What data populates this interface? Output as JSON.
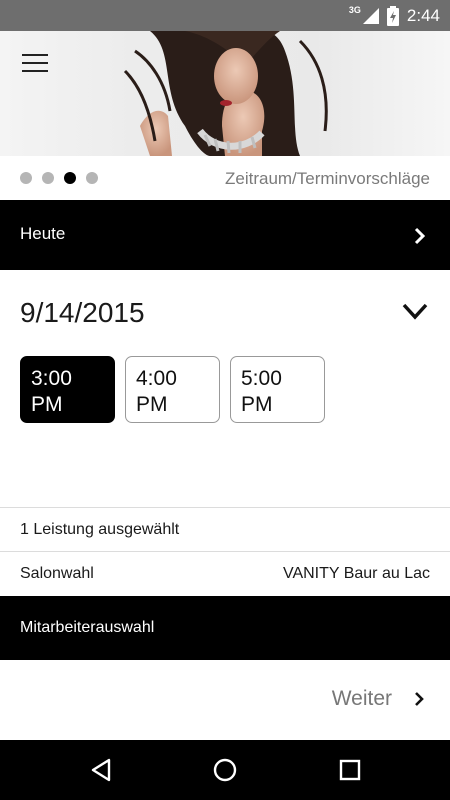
{
  "status_bar": {
    "network": "3G",
    "time": "2:44"
  },
  "header": {
    "menu_icon": "hamburger-menu-icon"
  },
  "pager": {
    "page_count": 4,
    "active_index": 2,
    "title": "Zeitraum/Terminvorschläge"
  },
  "today_bar": {
    "label": "Heute",
    "icon": "chevron-right-icon"
  },
  "date_selector": {
    "date": "9/14/2015",
    "icon": "chevron-down-icon"
  },
  "time_slots": [
    {
      "line1": "3:00",
      "line2": "PM",
      "selected": true
    },
    {
      "line1": "4:00",
      "line2": "PM",
      "selected": false
    },
    {
      "line1": "5:00",
      "line2": "PM",
      "selected": false
    }
  ],
  "services": {
    "label": "1 Leistung ausgewählt"
  },
  "salon": {
    "label": "Salonwahl",
    "value": "VANITY Baur au Lac"
  },
  "staff": {
    "label": "Mitarbeiterauswahl"
  },
  "next": {
    "label": "Weiter",
    "icon": "chevron-right-icon"
  },
  "nav_bar": {
    "back_icon": "back-triangle-icon",
    "home_icon": "home-circle-icon",
    "recents_icon": "recents-square-icon"
  },
  "colors": {
    "bar_black": "#000000",
    "status_gray": "#6e6e6e",
    "dot_inactive": "#b5b5b5",
    "muted_text": "#7a7a7a"
  }
}
